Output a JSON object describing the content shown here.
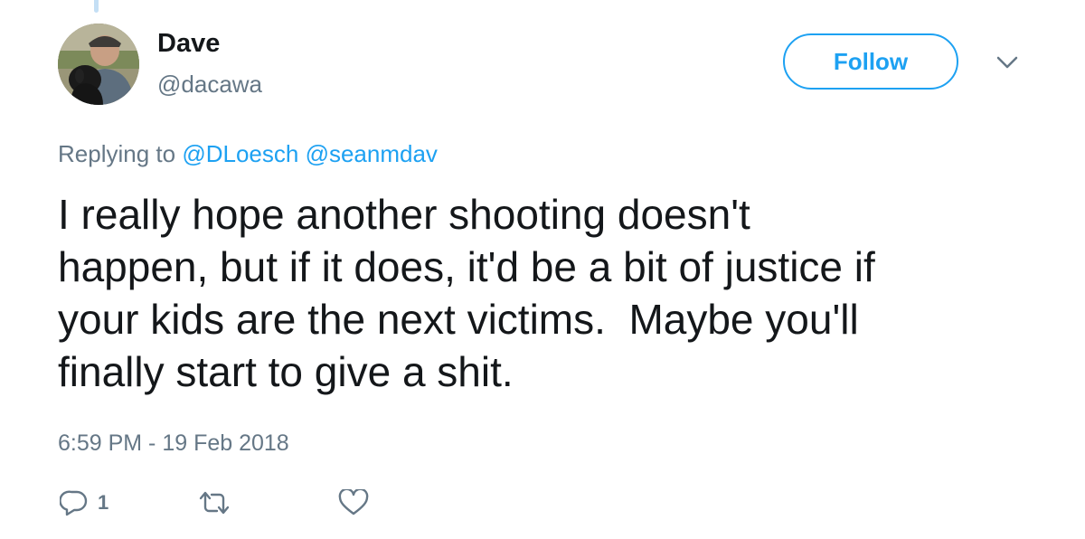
{
  "user": {
    "display_name": "Dave",
    "handle": "@dacawa",
    "avatar_icon": "profile-photo"
  },
  "follow": {
    "label": "Follow",
    "accent_color": "#1da1f2"
  },
  "menu": {
    "icon": "chevron-down-icon"
  },
  "reply_context": {
    "prefix": "Replying to",
    "mentions": [
      "@DLoesch",
      "@seanmdav"
    ]
  },
  "tweet": {
    "text": "I really hope another shooting doesn't\nhappen, but if it does, it'd be a bit of justice if\nyour kids are the next victims.  Maybe you'll\nfinally start to give a shit.",
    "timestamp": "6:59 PM - 19 Feb 2018"
  },
  "actions": {
    "reply_icon": "reply-icon",
    "reply_count": "1",
    "retweet_icon": "retweet-icon",
    "like_icon": "heart-icon"
  },
  "colors": {
    "text": "#14171a",
    "secondary": "#657786",
    "accent": "#1da1f2"
  }
}
